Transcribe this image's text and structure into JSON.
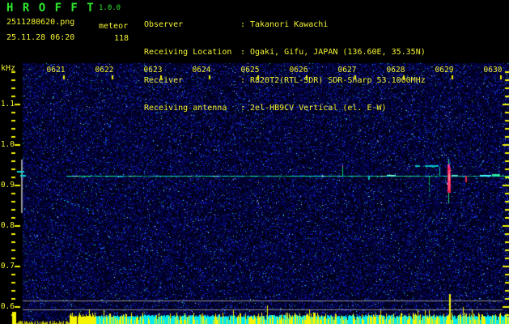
{
  "app": {
    "title": "H R O F F T",
    "version": "1.0.0"
  },
  "session": {
    "filename": "2511280620.png",
    "mode": "meteor",
    "timestamp": "25.11.28 06:20",
    "count": "118"
  },
  "station": {
    "rows": [
      {
        "label": "Observer",
        "sep": ":",
        "value": "Takanori Kawachi"
      },
      {
        "label": "Receiving Location",
        "sep": ":",
        "value": "Ogaki, Gifu, JAPAN (136.60E, 35.35N)"
      },
      {
        "label": "Receiver",
        "sep": ":",
        "value": "R820T2(RTL-SDR) SDR-Sharp 53.1000MHz"
      },
      {
        "label": "Receiving antenna",
        "sep": ":",
        "value": "2el-HB9CV Vertical (el. E-W)"
      }
    ]
  },
  "spectrogram": {
    "unit_label": "kHz",
    "freq_tick_labels": [
      "1.1",
      "1.0",
      "0.9",
      "0.8",
      "0.7",
      "0.6"
    ],
    "time_tick_labels": [
      "0621",
      "0622",
      "0623",
      "0624",
      "0625",
      "0626",
      "0627",
      "0628",
      "0629",
      "0630"
    ],
    "carrier_line_freq_khz": 0.92,
    "noise_band_marker_khz": [
      0.62,
      0.6
    ],
    "events": [
      {
        "time": "0627",
        "freq_khz": 0.93,
        "type": "weak-echo"
      },
      {
        "time": "0629",
        "freq_khz": 0.92,
        "type": "strong-echo"
      }
    ]
  },
  "colors": {
    "text_yellow": "#f2f232",
    "text_green": "#2ee82e",
    "tick_yellow": "#f5f500",
    "carrier_green": "#28dc8c",
    "echo_red": "#ee1e4e",
    "level_cyan": "#00e8f0",
    "level_yellow": "#f5f500",
    "marker_gray": "#949494",
    "background": "#000000"
  }
}
